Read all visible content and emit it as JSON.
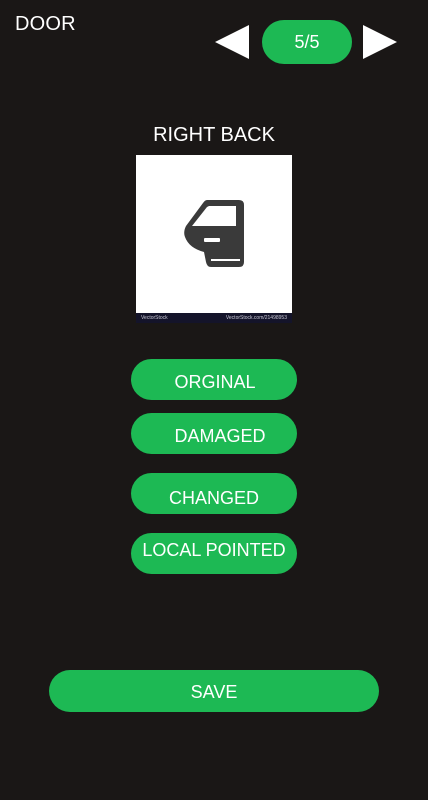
{
  "header": {
    "title": "DOOR",
    "counter": "5/5",
    "prev_icon": "triangle-left-icon",
    "next_icon": "triangle-right-icon"
  },
  "part": {
    "label": "RIGHT BACK",
    "image_icon": "car-door-icon",
    "watermark_left": "VectorStock",
    "watermark_right": "VectorStock.com/21498953"
  },
  "options": [
    {
      "label": "ORGINAL"
    },
    {
      "label": "DAMAGED"
    },
    {
      "label": "CHANGED"
    },
    {
      "label": "LOCAL POINTED"
    }
  ],
  "save_label": "SAVE",
  "colors": {
    "background": "#1a1716",
    "accent": "#1db954",
    "text": "#ffffff"
  }
}
